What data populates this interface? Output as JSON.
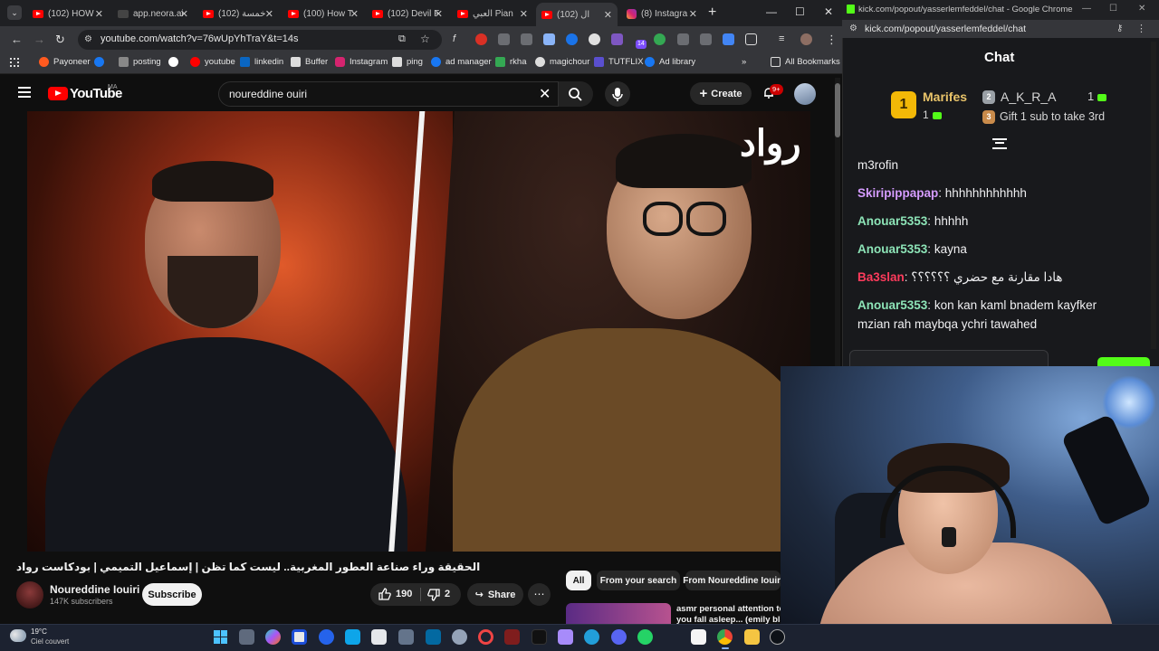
{
  "chrome": {
    "tabs": [
      {
        "label": "(102) HOW",
        "icon": "youtube-icon"
      },
      {
        "label": "app.neora.ai",
        "icon": "neora-icon"
      },
      {
        "label": "(102) خمسة",
        "icon": "youtube-icon"
      },
      {
        "label": "(100) How T",
        "icon": "youtube-icon"
      },
      {
        "label": "(102) Devil F",
        "icon": "youtube-icon"
      },
      {
        "label": "العبي Pian",
        "icon": "youtube-icon"
      },
      {
        "label": "(102) ال",
        "icon": "youtube-icon"
      },
      {
        "label": "(8) Instagra",
        "icon": "instagram-icon"
      }
    ],
    "address": "youtube.com/watch?v=76wUpYhTraY&t=14s",
    "ext_badge": "14",
    "bookmarks": [
      {
        "label": "Payoneer",
        "color": "#ff5a1f"
      },
      {
        "label": "",
        "color": "#1877f2"
      },
      {
        "label": "posting",
        "color": "#e0e0e0"
      },
      {
        "label": "",
        "color": "#4285f4"
      },
      {
        "label": "youtube",
        "color": "#ff0000"
      },
      {
        "label": "linkedin",
        "color": "#0a66c2"
      },
      {
        "label": "Buffer",
        "color": "#e0e0e0"
      },
      {
        "label": "Instagram",
        "color": "#d6246f"
      },
      {
        "label": "ping",
        "color": "#e0e0e0"
      },
      {
        "label": "ad manager",
        "color": "#1877f2"
      },
      {
        "label": "rkha",
        "color": "#34a853"
      },
      {
        "label": "magichour",
        "color": "#e0e0e0"
      },
      {
        "label": "TUTFLIX",
        "color": "#5a4fcf"
      },
      {
        "label": "Ad library",
        "color": "#1877f2"
      }
    ],
    "all_bookmarks": "All Bookmarks"
  },
  "youtube": {
    "wordmark": "YouTube",
    "country": "MA",
    "search_query": "noureddine ouiri",
    "create_label": "Create",
    "notif_badge": "9+",
    "video_overlay_logo": "رواد",
    "video_title": "الحقيقة وراء صناعة العطور المغربية.. ليست كما تظن | إسماعيل التميمي | بودكاست رواد",
    "channel_name": "Noureddine Iouiri",
    "channel_subs": "147K subscribers",
    "subscribe_label": "Subscribe",
    "likes": "190",
    "dislikes": "2",
    "share_label": "Share",
    "chips": [
      "All",
      "From your search",
      "From Noureddine Iouiri"
    ],
    "rec_title": "asmr personal attention to you fall asleep... (emily bla"
  },
  "kick": {
    "window_title": "kick.com/popout/yasserlemfeddel/chat - Google Chrome",
    "address": "kick.com/popout/yasserlemfeddel/chat",
    "heading": "Chat",
    "leaderboard": {
      "first_name": "Marifes",
      "first_count": "1",
      "first_rank": "1",
      "second_name": "A_K_R_A",
      "second_count": "1",
      "second_rank": "2",
      "third_rank": "3",
      "third_text": "Gift 1 sub to take 3rd"
    },
    "messages": [
      {
        "user": "",
        "text": "m3rofin",
        "color": "#efeff1"
      },
      {
        "user": "Skiripippapap",
        "text": "hhhhhhhhhhhh",
        "color": "#d59cff"
      },
      {
        "user": "Anouar5353",
        "text": "hhhhh",
        "color": "#8de4b7"
      },
      {
        "user": "Anouar5353",
        "text": "kayna",
        "color": "#8de4b7"
      },
      {
        "user": "Ba3slan",
        "text": "هادا مقارنة مع حضري ؟؟؟؟؟؟",
        "color": "#ff3b5c"
      },
      {
        "user": "Anouar5353",
        "text": "kon kan kaml bnadem kayfker mzian rah maybqa ychri tawahed",
        "color": "#8de4b7"
      }
    ]
  },
  "taskbar": {
    "temp": "19°C",
    "weather": "Ciel couvert",
    "apps": [
      "windows-start-icon",
      "task-view-icon",
      "copilot-icon",
      "app-l-icon",
      "app-blue-icon",
      "vscode-icon",
      "file-app-icon",
      "store-icon",
      "outlook-icon",
      "settings-icon",
      "opera-icon",
      "winrar-icon",
      "tiktok-icon",
      "photos-icon",
      "telegram-icon",
      "discord-icon",
      "whatsapp-icon",
      "notion-icon",
      "chrome-icon",
      "explorer-icon",
      "github-icon"
    ]
  }
}
